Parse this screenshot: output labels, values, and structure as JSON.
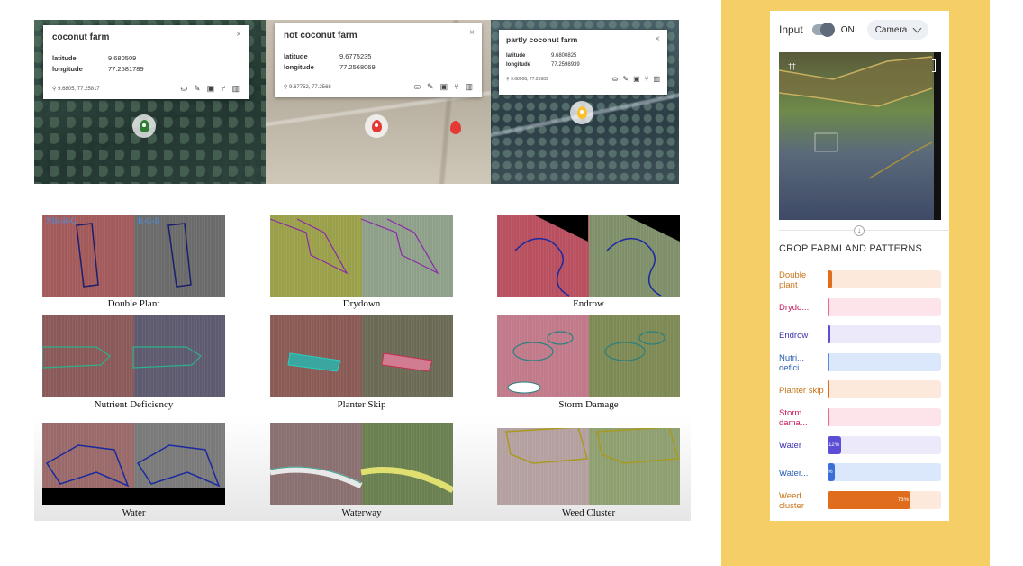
{
  "maps": [
    {
      "title": "coconut farm",
      "latitude_label": "latitude",
      "latitude": "9.680509",
      "longitude_label": "longitude",
      "longitude": "77.2581789",
      "coords": "9.6805, 77.25817",
      "pin_color": "#2e7d32"
    },
    {
      "title": "not coconut farm",
      "latitude_label": "latitude",
      "latitude": "9.6775235",
      "longitude_label": "longitude",
      "longitude": "77.2568069",
      "coords": "9.67752, 77.2568",
      "pin_color": "#e53935"
    },
    {
      "title": "partly coconut farm",
      "latitude_label": "latitude",
      "latitude": "9.6800825",
      "longitude_label": "longitude",
      "longitude": "77.2598939",
      "coords": "9.68008, 77.25989",
      "pin_color": "#fbc02d"
    }
  ],
  "close_glyph": "×",
  "tile_overlays": {
    "left": "NIR-R-G",
    "right": "R-G-B"
  },
  "patterns": [
    {
      "caption": "Double Plant",
      "left_color": "#a35a5a",
      "right_color": "#6b6b6b",
      "outline": "#1a1f6e"
    },
    {
      "caption": "Drydown",
      "left_color": "#9aa04a",
      "right_color": "#8fa08a",
      "outline": "#8a2aa8"
    },
    {
      "caption": "Endrow",
      "left_color": "#b85060",
      "right_color": "#7f8f6a",
      "outline": "#1b2aa0"
    },
    {
      "caption": "Nutrient Deficiency",
      "left_color": "#8a5a5a",
      "right_color": "#5e5a70",
      "outline": "#2fb08a"
    },
    {
      "caption": "Planter Skip",
      "left_color": "#8a5a55",
      "right_color": "#6a6a55",
      "outline": "#2ad0c0"
    },
    {
      "caption": "Storm Damage",
      "left_color": "#c07a8a",
      "right_color": "#7e8a55",
      "outline": "#2a8080"
    },
    {
      "caption": "Water",
      "left_color": "#9a6a6a",
      "right_color": "#7a7a7a",
      "outline": "#1a2a9e"
    },
    {
      "caption": "Waterway",
      "left_color": "#8a7070",
      "right_color": "#6a8050",
      "outline": "#3aa090"
    },
    {
      "caption": "Weed Cluster",
      "left_color": "#b5a0a0",
      "right_color": "#8fa070",
      "outline": "#a89a20"
    }
  ],
  "panel": {
    "input_label": "Input",
    "toggle_state": "ON",
    "camera_option": "Camera",
    "section_title": "CROP FARMLAND PATTERNS",
    "bars": [
      {
        "label": "Double plant",
        "value": 0.04,
        "value_text": "",
        "color": "#e06d1e",
        "track": "#fde8dc",
        "text_color": "#c8741a"
      },
      {
        "label": "Drydo...",
        "value": 0.0,
        "value_text": "",
        "color": "#e86a8a",
        "track": "#fde4ea",
        "text_color": "#c2185b"
      },
      {
        "label": "Endrow",
        "value": 0.02,
        "value_text": "",
        "color": "#5c4dd6",
        "track": "#ece9fb",
        "text_color": "#3f33b0"
      },
      {
        "label": "Nutri... defici...",
        "value": 0.01,
        "value_text": "",
        "color": "#5b8de8",
        "track": "#dbe7fb",
        "text_color": "#2a5db0"
      },
      {
        "label": "Planter skip",
        "value": 0.01,
        "value_text": "",
        "color": "#e06d1e",
        "track": "#fde8dc",
        "text_color": "#c8741a"
      },
      {
        "label": "Storm dama...",
        "value": 0.0,
        "value_text": "",
        "color": "#e86a8a",
        "track": "#fde4ea",
        "text_color": "#c2185b"
      },
      {
        "label": "Water",
        "value": 0.12,
        "value_text": "12%",
        "color": "#5c4dd6",
        "track": "#ece9fb",
        "text_color": "#3f33b0"
      },
      {
        "label": "Water...",
        "value": 0.06,
        "value_text": "%",
        "color": "#3a6fd8",
        "track": "#dbe7fb",
        "text_color": "#2a5db0"
      },
      {
        "label": "Weed cluster",
        "value": 0.73,
        "value_text": "73%",
        "color": "#e06d1e",
        "track": "#fde8dc",
        "text_color": "#c8741a"
      }
    ]
  }
}
